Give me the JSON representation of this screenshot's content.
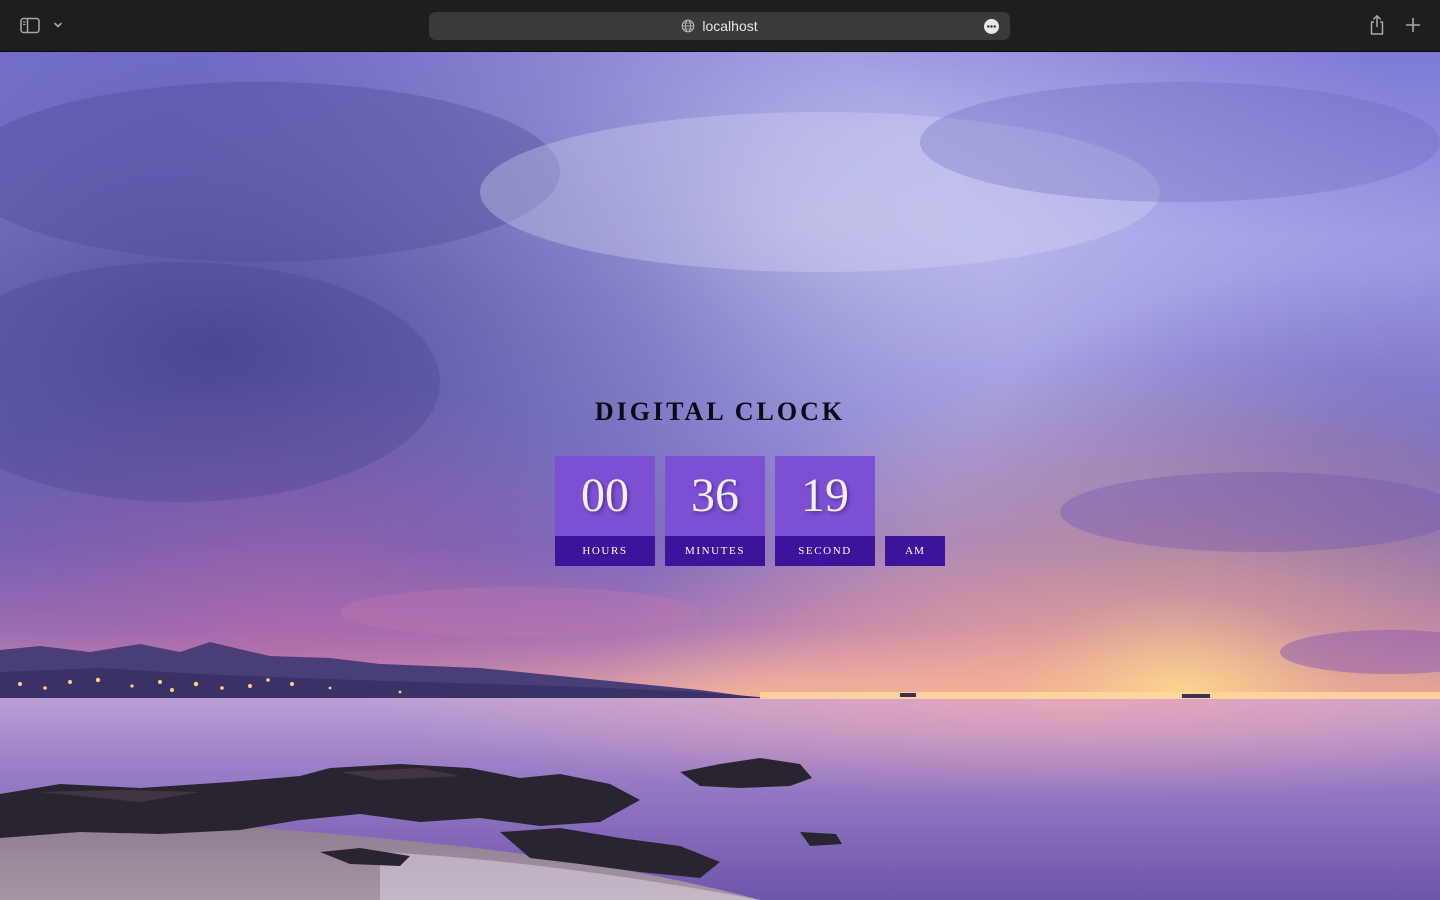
{
  "browser": {
    "url": "localhost",
    "icons": {
      "sidebar": "sidebar-icon",
      "chevron": "chevron-down-icon",
      "globe": "globe-icon",
      "more": "more-icon",
      "share": "share-icon",
      "new_tab": "plus-icon"
    }
  },
  "page": {
    "title": "DIGITAL CLOCK",
    "clock": {
      "hours": {
        "value": "00",
        "label": "HOURS"
      },
      "minutes": {
        "value": "36",
        "label": "MINUTES"
      },
      "seconds": {
        "value": "19",
        "label": "SECOND"
      },
      "period": "AM"
    },
    "background": "sunset over sea with rocky shore and purple clouds"
  },
  "colors": {
    "digit_box": "#7d4fd3",
    "label_box": "#3c139a",
    "toolbar": "#1e1e1e",
    "address_bar": "#3a3a3c"
  }
}
